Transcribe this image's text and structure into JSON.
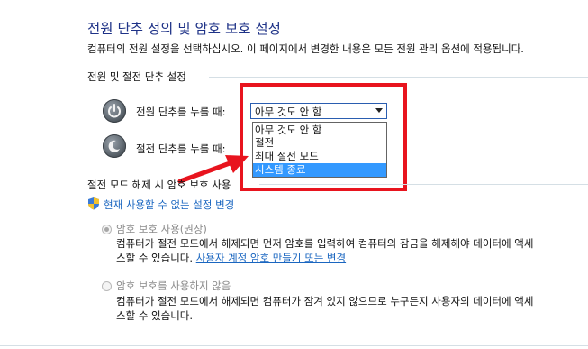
{
  "header": {
    "title": "전원 단추 정의 및 암호 보호 설정",
    "description": "컴퓨터의 전원 설정을 선택하십시오. 이 페이지에서 변경한 내용은 모든 전원 관리 옵션에 적용됩니다."
  },
  "power_section": {
    "heading": "전원 및 절전 단추 설정",
    "power_button_label": "전원 단추를 누를 때:",
    "sleep_button_label": "절전 단추를 누를 때:",
    "power_button_value": "아무 것도 안 함",
    "dropdown_options": [
      "아무 것도 안 함",
      "절전",
      "최대 절전 모드",
      "시스템 종료"
    ],
    "highlighted_option": "시스템 종료"
  },
  "password_section": {
    "heading": "절전 모드 해제 시 암호 보호 사용",
    "change_settings_link": "현재 사용할 수 없는 설정 변경",
    "option_require": {
      "label": "암호 보호 사용(권장)",
      "text_line1": "컴퓨터가 절전 모드에서 해제되면 먼저 암호를 입력하여 컴퓨터의 잠금을 해제해야 데이터에 액세",
      "text_line2_prefix": "스할 수 있습니다.",
      "link": "사용자 계정 암호 만들기 또는 변경"
    },
    "option_none": {
      "label": "암호 보호를 사용하지 않음",
      "text_line1": "컴퓨터가 절전 모드에서 해제되면 컴퓨터가 잠겨 있지 않으므로 누구든지 사용자의 데이터에 액세",
      "text_line2": "스할 수 있습니다."
    }
  },
  "colors": {
    "title": "#1e3287",
    "link": "#1a66c0",
    "annotation_red": "#e8141e",
    "selection_blue": "#3399ff"
  }
}
